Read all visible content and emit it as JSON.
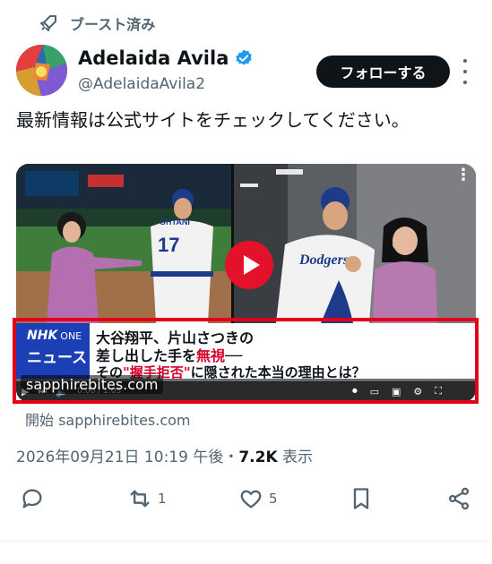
{
  "boost": {
    "label": "ブースト済み",
    "icon": "rocket-icon"
  },
  "author": {
    "name": "Adelaida Avila",
    "handle": "@AdelaidaAvila2",
    "verified": true,
    "avatar": "colorful-abstract-avatar"
  },
  "follow_label": "フォローする",
  "post_text": "最新情報は公式サイトをチェックしてください。",
  "media": {
    "channel_logo": "NHK",
    "channel_logo_suffix": "ONE",
    "channel_label": "ニュース",
    "headline_line1": "大谷翔平、片山さつきの",
    "headline_line2_prefix": "差し出した手を",
    "headline_line2_red": "無視",
    "headline_line2_dash": "──",
    "headline_line3_prefix": "その",
    "headline_line3_red": "\"握手拒否\"",
    "headline_line3_suffix": "に隠された本当の理由とは？",
    "watermark": "sapphirebites.com",
    "player_time": "0:00 / 1:03",
    "jersey_number": "17",
    "jersey_name": "OHTANI",
    "team": "Dodgers",
    "accent_red": "#e3122a"
  },
  "source_label": "開始 sapphirebites.com",
  "meta": {
    "timestamp": "2026年09月21日 10:19 午後",
    "separator": "・",
    "views": "7.2K",
    "views_label": "表示"
  },
  "actions": {
    "reply_count": "",
    "repost_count": "1",
    "like_count": "5"
  }
}
